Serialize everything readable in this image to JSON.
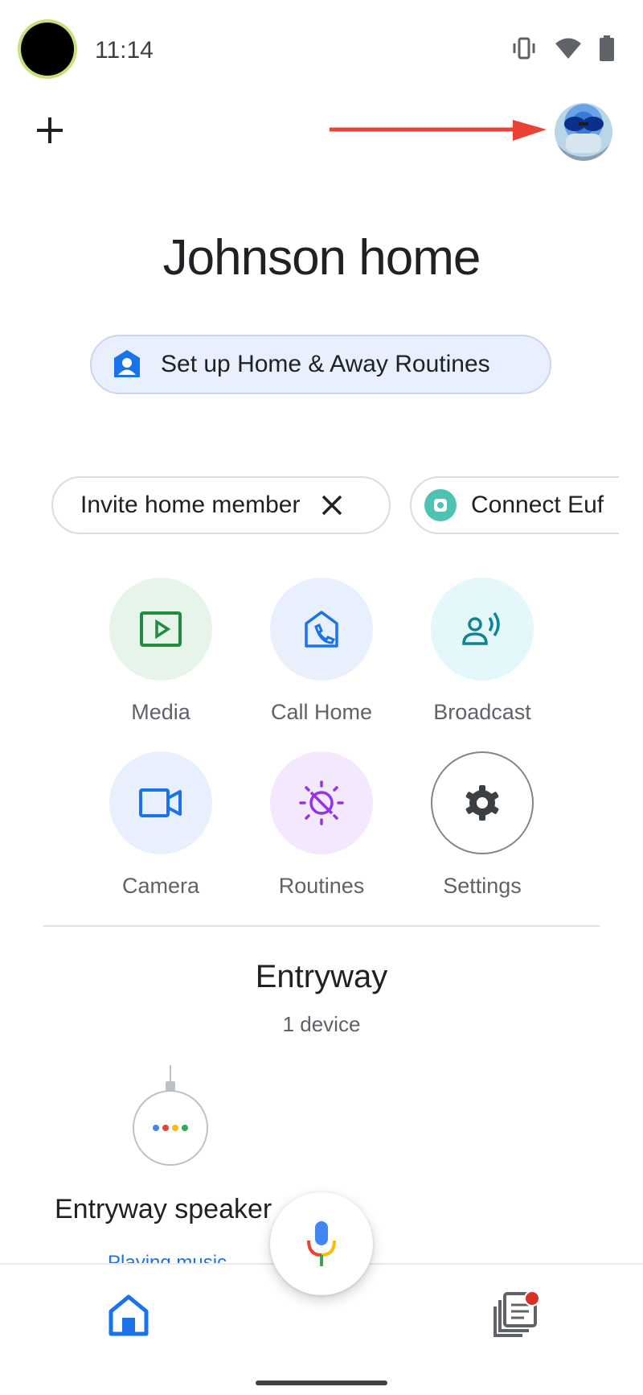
{
  "status_bar": {
    "time": "11:14",
    "icons": [
      "vibrate-icon",
      "wifi-icon",
      "battery-icon"
    ]
  },
  "header": {
    "add_icon": "plus-icon",
    "avatar": "account-avatar",
    "annotation": "red-arrow-pointing-to-avatar"
  },
  "home": {
    "title": "Johnson home"
  },
  "routine_chip": {
    "label": "Set up Home & Away Routines",
    "icon": "person-home-icon"
  },
  "suggestions": [
    {
      "label": "Invite home member",
      "action_icon": "close-icon"
    },
    {
      "label": "Connect Euf",
      "icon": "eufy-icon"
    }
  ],
  "shortcuts": [
    {
      "label": "Media",
      "icon": "media-icon",
      "bg": "#e6f4ea"
    },
    {
      "label": "Call Home",
      "icon": "call-home-icon",
      "bg": "#e8f0fe"
    },
    {
      "label": "Broadcast",
      "icon": "broadcast-icon",
      "bg": "#e4f7fb"
    },
    {
      "label": "Camera",
      "icon": "camera-icon",
      "bg": "#e8f0fe"
    },
    {
      "label": "Routines",
      "icon": "routines-icon",
      "bg": "#f3e8fd"
    },
    {
      "label": "Settings",
      "icon": "gear-icon",
      "bg": "#ffffff"
    }
  ],
  "room": {
    "title": "Entryway",
    "subtitle": "1 device"
  },
  "device": {
    "name": "Entryway speaker",
    "status": "Playing music"
  },
  "bottom_nav": {
    "home_icon": "home-icon",
    "feed_icon": "feed-icon",
    "mic_icon": "mic-icon"
  },
  "colors": {
    "accent": "#1a73e8",
    "arrow": "#ea4335",
    "badge": "#d93025"
  }
}
